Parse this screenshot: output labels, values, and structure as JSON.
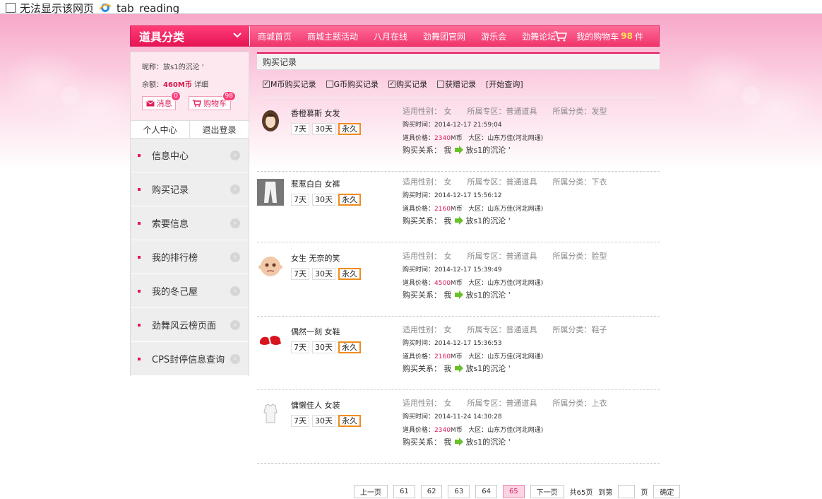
{
  "browser": {
    "tabs": [
      {
        "title": "无法显示该网页"
      },
      {
        "title": "tab_reading"
      }
    ]
  },
  "nav": {
    "category_label": "道具分类",
    "links": [
      "商城首页",
      "商城主题活动",
      "八月在线",
      "劲舞团官网",
      "游乐会",
      "劲舞论坛"
    ],
    "cart_label": "我的购物车",
    "cart_count": "98",
    "cart_unit": "件"
  },
  "user": {
    "nickname_label": "昵称：放s1的沉沦 '",
    "balance_label": "余额：",
    "balance_value": "460M币",
    "detail_link": "详细",
    "message_label": "消息",
    "message_count": "0",
    "cart_label": "购物车",
    "cart_count": "98",
    "tab_center": "个人中心",
    "tab_logout": "退出登录"
  },
  "sidebar": {
    "items": [
      {
        "label": "信息中心"
      },
      {
        "label": "购买记录"
      },
      {
        "label": "索要信息"
      },
      {
        "label": "我的排行榜"
      },
      {
        "label": "我的冬己屋"
      },
      {
        "label": "劲舞风云榜页面"
      },
      {
        "label": "CPS封停信息查询"
      }
    ]
  },
  "content": {
    "header": "购买记录",
    "filters": [
      {
        "label": "M币购买记录",
        "checked": true
      },
      {
        "label": "G币购买记录",
        "checked": false
      },
      {
        "label": "购买记录",
        "checked": true
      },
      {
        "label": "获赠记录",
        "checked": false
      }
    ],
    "query_label": "[开始查询]",
    "items": [
      {
        "name": "香橙慕斯 女发",
        "gender": "适用性别： 女",
        "zone": "所属专区：普通道具",
        "category": "所属分类：发型",
        "time": "购买时间：2014-12-17 21:59:04",
        "price_label": "道具价格：",
        "price_value": "2340",
        "price_unit": "M币",
        "region": "大区：山东万佳(河北网通)",
        "relation_label": "购买关系： 我",
        "relation_target": "放s1的沉沦 '",
        "periods": [
          "7天",
          "30天",
          "永久"
        ],
        "icon": "hair-icon"
      },
      {
        "name": "惹惹白白 女裤",
        "gender": "适用性别： 女",
        "zone": "所属专区：普通道具",
        "category": "所属分类：下衣",
        "time": "购买时间：2014-12-17 15:56:12",
        "price_label": "道具价格：",
        "price_value": "2160",
        "price_unit": "M币",
        "region": "大区：山东万佳(河北网通)",
        "relation_label": "购买关系： 我",
        "relation_target": "放s1的沉沦 '",
        "periods": [
          "7天",
          "30天",
          "永久"
        ],
        "icon": "pants-icon"
      },
      {
        "name": "女生 无奈的笑",
        "gender": "适用性别： 女",
        "zone": "所属专区：普通道具",
        "category": "所属分类：脸型",
        "time": "购买时间：2014-12-17 15:39:49",
        "price_label": "道具价格：",
        "price_value": "4500",
        "price_unit": "M币",
        "region": "大区：山东万佳(河北网通)",
        "relation_label": "购买关系： 我",
        "relation_target": "放s1的沉沦 '",
        "periods": [
          "7天",
          "30天",
          "永久"
        ],
        "icon": "face-icon"
      },
      {
        "name": "偶然一刻 女鞋",
        "gender": "适用性别： 女",
        "zone": "所属专区：普通道具",
        "category": "所属分类：鞋子",
        "time": "购买时间：2014-12-17 15:36:53",
        "price_label": "道具价格：",
        "price_value": "2160",
        "price_unit": "M币",
        "region": "大区：山东万佳(河北网通)",
        "relation_label": "购买关系： 我",
        "relation_target": "放s1的沉沦 '",
        "periods": [
          "7天",
          "30天",
          "永久"
        ],
        "icon": "shoes-icon"
      },
      {
        "name": "慵懒佳人 女装",
        "gender": "适用性别： 女",
        "zone": "所属专区：普通道具",
        "category": "所属分类：上衣",
        "time": "购买时间：2014-11-24 14:30:28",
        "price_label": "道具价格：",
        "price_value": "2340",
        "price_unit": "M币",
        "region": "大区：山东万佳(河北网通)",
        "relation_label": "购买关系： 我",
        "relation_target": "放s1的沉沦 '",
        "periods": [
          "7天",
          "30天",
          "永久"
        ],
        "icon": "shirt-icon"
      }
    ]
  },
  "pager": {
    "prev": "上一页",
    "pages": [
      "61",
      "62",
      "63",
      "64",
      "65"
    ],
    "current": "65",
    "next": "下一页",
    "total": "共65页",
    "goto_label": "到第",
    "page_unit": "页",
    "confirm": "确定"
  }
}
